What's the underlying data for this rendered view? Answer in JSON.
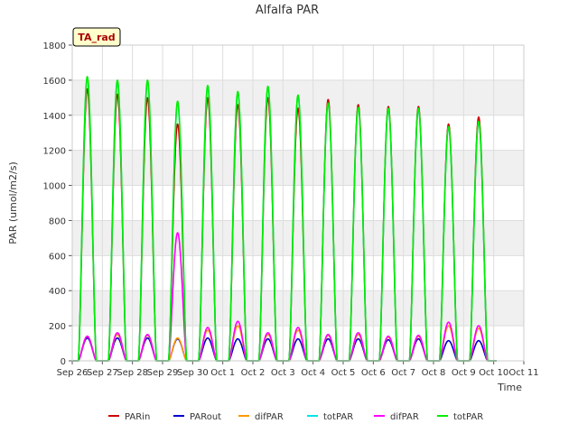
{
  "chart_data": {
    "type": "line",
    "title": "Alfalfa PAR",
    "xlabel": "Time",
    "ylabel": "PAR (umol/m2/s)",
    "ylim": [
      0,
      1800
    ],
    "yticks": [
      0,
      200,
      400,
      600,
      800,
      1000,
      1200,
      1400,
      1600,
      1800
    ],
    "xlim": [
      0,
      15
    ],
    "xtick_labels": [
      "Sep 26",
      "Sep 27",
      "Sep 28",
      "Sep 29",
      "Sep 30",
      "Oct 1",
      "Oct 2",
      "Oct 3",
      "Oct 4",
      "Oct 5",
      "Oct 6",
      "Oct 7",
      "Oct 8",
      "Oct 9",
      "Oct 10",
      "Oct 11"
    ],
    "annotation": "TA_rad",
    "grid": true,
    "legend_position": "bottom",
    "day_offsets": [
      0.5,
      1.5,
      2.5,
      3.5,
      4.5,
      5.5,
      6.5,
      7.5,
      8.5,
      9.5,
      10.5,
      11.5,
      12.5,
      13.5
    ],
    "series": [
      {
        "name": "PARin",
        "color": "#cc0000",
        "peaks": [
          1550,
          1520,
          1500,
          1350,
          1500,
          1460,
          1500,
          1440,
          1490,
          1460,
          1450,
          1450,
          1350,
          1390
        ]
      },
      {
        "name": "PARout",
        "color": "#0000cc",
        "peaks": [
          130,
          130,
          130,
          125,
          130,
          125,
          125,
          125,
          125,
          125,
          120,
          125,
          115,
          115
        ]
      },
      {
        "name": "difPAR",
        "color": "#ff9900",
        "peaks": [
          140,
          150,
          145,
          130,
          175,
          200,
          150,
          175,
          145,
          150,
          135,
          140,
          200,
          185
        ]
      },
      {
        "name": "totPAR",
        "color": "#00e5e5",
        "peaks": [
          1610,
          1590,
          1590,
          1470,
          1560,
          1525,
          1555,
          1510,
          1465,
          1440,
          1430,
          1430,
          1330,
          1360
        ]
      },
      {
        "name": "difPAR",
        "color": "#ff00ff",
        "peaks": [
          140,
          160,
          150,
          730,
          190,
          225,
          160,
          190,
          150,
          160,
          140,
          145,
          220,
          200
        ]
      },
      {
        "name": "totPAR",
        "color": "#00ee00",
        "peaks": [
          1620,
          1600,
          1600,
          1480,
          1570,
          1535,
          1565,
          1515,
          1470,
          1445,
          1440,
          1440,
          1335,
          1365
        ]
      }
    ]
  }
}
